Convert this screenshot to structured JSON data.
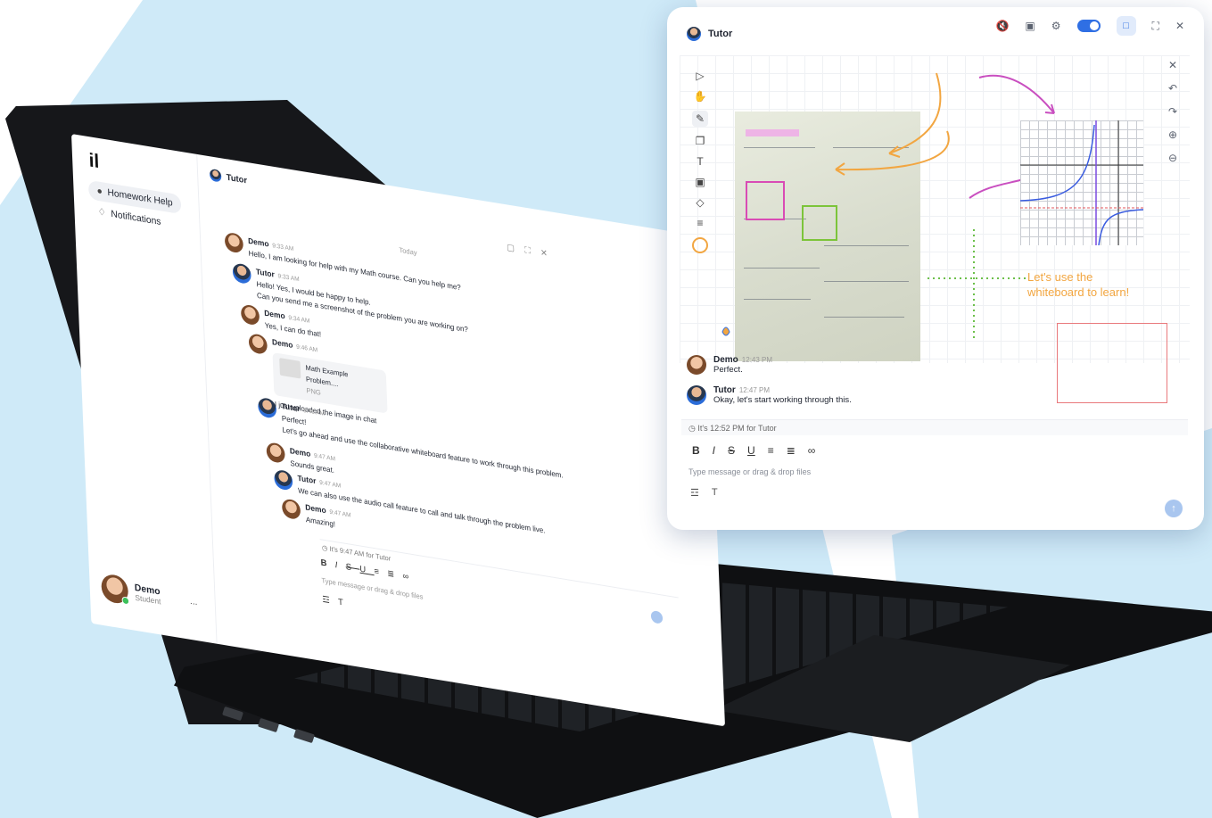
{
  "colors": {
    "background_blue": "#cfeaf8",
    "accent_blue": "#2f6fe4",
    "marker_orange": "#f2a641",
    "marker_pink": "#c94fc0",
    "marker_green": "#6cc04a"
  },
  "laptop": {
    "logo": "il",
    "nav": [
      {
        "icon": "homework-icon",
        "label": "Homework Help"
      },
      {
        "icon": "bell-icon",
        "label": "Notifications"
      }
    ],
    "user": {
      "name": "Demo",
      "role": "Student",
      "more": "..."
    },
    "chat": {
      "title": "Tutor",
      "date_divider": "Today",
      "messages": [
        {
          "who": "Demo",
          "time": "9:33 AM",
          "lines": [
            "Hello, I am looking for help with my Math course. Can you help me?"
          ]
        },
        {
          "who": "Tutor",
          "time": "9:33 AM",
          "lines": [
            "Hello! Yes, I would be happy to help.",
            "Can you send me a screenshot of the problem you are working on?"
          ]
        },
        {
          "who": "Demo",
          "time": "9:34 AM",
          "lines": [
            "Yes, I can do that!"
          ]
        },
        {
          "who": "Demo",
          "time": "9:46 AM",
          "lines": [
            "I just uploaded the image in chat"
          ],
          "file": {
            "name": "Math Example Problem....",
            "type": "PNG"
          }
        },
        {
          "who": "Tutor",
          "time": "9:46 AM",
          "lines": [
            "Perfect!",
            "Let's go ahead and use the collaborative whiteboard feature to work through this problem."
          ]
        },
        {
          "who": "Demo",
          "time": "9:47 AM",
          "lines": [
            "Sounds great."
          ]
        },
        {
          "who": "Tutor",
          "time": "9:47 AM",
          "lines": [
            "We can also use the audio call feature to call and talk through the problem live."
          ]
        },
        {
          "who": "Demo",
          "time": "9:47 AM",
          "lines": [
            "Amazing!"
          ]
        }
      ],
      "timezone_note": "It's 9:47 AM for Tutor",
      "input_placeholder": "Type message or drag & drop files"
    }
  },
  "whiteboard_window": {
    "title": "Tutor",
    "note_lines": [
      "Let's use the",
      "whiteboard to learn!"
    ],
    "messages": [
      {
        "who": "Demo",
        "time": "12:43 PM",
        "text": "Perfect."
      },
      {
        "who": "Tutor",
        "time": "12:47 PM",
        "text": "Okay, let's start working through this."
      }
    ],
    "timezone_note": "It's 12:52 PM for Tutor",
    "format_buttons": [
      "B",
      "I",
      "S",
      "U"
    ],
    "input_placeholder": "Type message or drag & drop files",
    "send_icon": "arrow-up-icon"
  }
}
